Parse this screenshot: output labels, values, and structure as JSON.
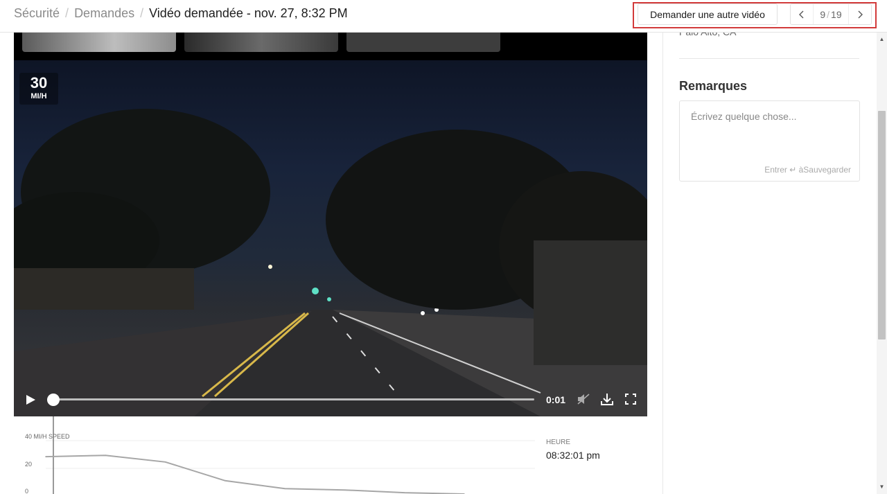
{
  "header": {
    "breadcrumbs": [
      "Sécurité",
      "Demandes"
    ],
    "separator": "/",
    "title": "Vidéo demandée - nov. 27, 8:32 PM",
    "request_button": "Demander une autre vidéo",
    "pager": {
      "current": "9",
      "total": "19",
      "divider": "/"
    }
  },
  "video": {
    "speed_value": "30",
    "speed_unit": "MI/H",
    "time": "0:01",
    "progress": 0.01,
    "icons": [
      "play-icon",
      "mute-icon",
      "download-icon",
      "fullscreen-icon"
    ]
  },
  "chart": {
    "y_label": "40 MI/H SPEED",
    "ticks": [
      "20",
      "0"
    ],
    "heure_label": "HEURE",
    "heure_value": "08:32:01 pm"
  },
  "chart_data": {
    "type": "line",
    "ylabel": "40 MI/H SPEED",
    "ylim": [
      0,
      40
    ],
    "series": [
      {
        "values": [
          28,
          29,
          24,
          10,
          4,
          3,
          1,
          0
        ]
      }
    ]
  },
  "sidebar": {
    "location": "Palo Alto, CA",
    "notes_title": "Remarques",
    "notes_placeholder": "Écrivez quelque chose...",
    "notes_hint": "Entrer ↵ àSauvegarder"
  },
  "colors": {
    "highlight": "#d23a3a",
    "chart_line": "#a6a6a6"
  }
}
